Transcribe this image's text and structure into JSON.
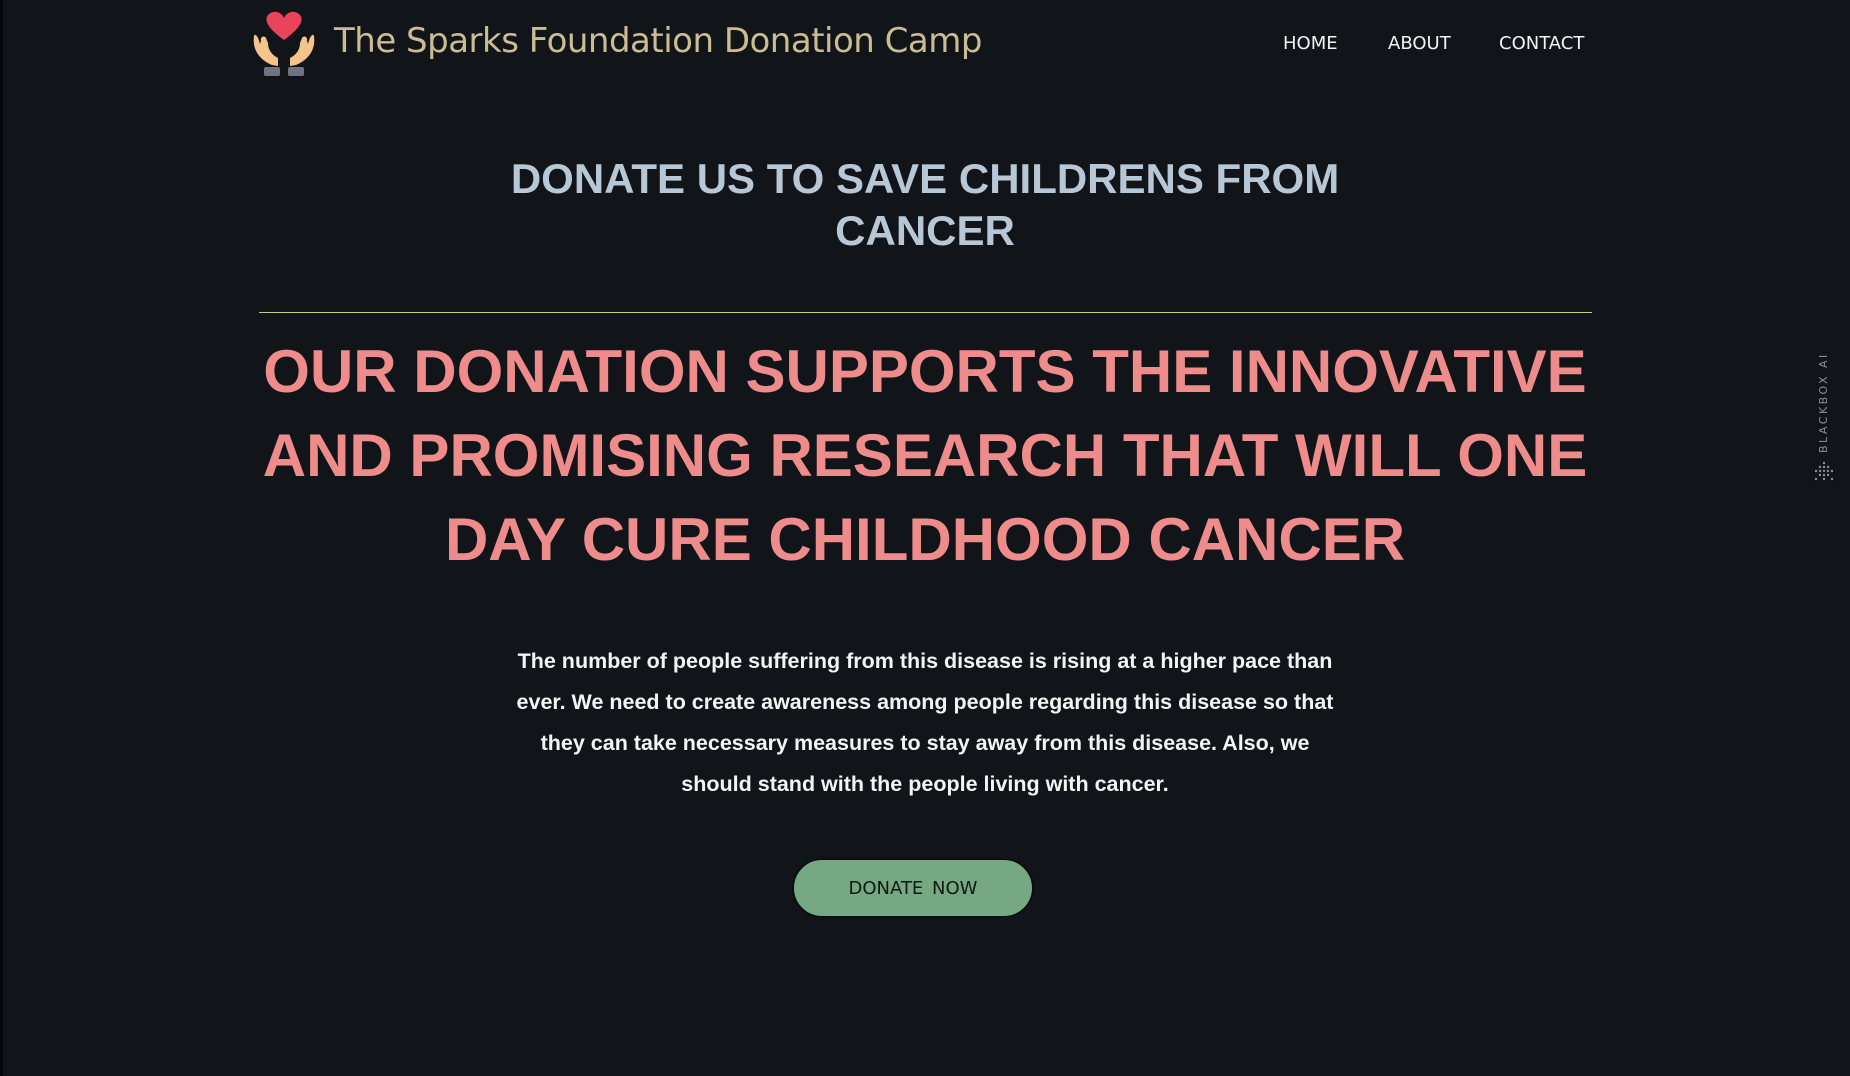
{
  "header": {
    "logo_icon": "heart-in-hands-icon",
    "site_title": "The Sparks Foundation Donation Camp",
    "nav": [
      {
        "label": "HOME"
      },
      {
        "label": "ABOUT"
      },
      {
        "label": "CONTACT"
      }
    ]
  },
  "hero": {
    "headline": "DONATE US TO SAVE CHILDRENS FROM CANCER",
    "mission": "OUR DONATION SUPPORTS THE INNOVATIVE AND PROMISING RESEARCH THAT WILL ONE DAY CURE CHILDHOOD CANCER",
    "body": "The number of people suffering from this disease is rising at a higher pace than ever. We need to create awareness among people regarding this disease so that they can take necessary measures to stay away from this disease. Also, we should stand with the people living with cancer.",
    "cta_label": "DONATE  NOW"
  },
  "side_widget": {
    "label": "BLACKBOX AI",
    "icon": "dot-grid-icon"
  },
  "colors": {
    "background": "#111419",
    "title": "#cbbd93",
    "headline": "#b7c7d6",
    "mission": "#ee8b8b",
    "divider": "#c9c48a",
    "button": "#76a884"
  }
}
